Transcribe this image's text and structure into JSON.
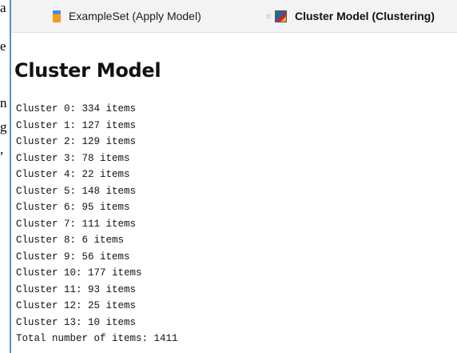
{
  "left_strip_letters": [
    "a",
    "e",
    "n",
    "g",
    ","
  ],
  "tabs": [
    {
      "label": "ExampleSet (Apply Model)",
      "icon": "table-icon",
      "active": false
    },
    {
      "label": "Cluster Model (Clustering)",
      "icon": "cluster-model-icon",
      "active": true
    }
  ],
  "close_glyph": "×",
  "heading": "Cluster Model",
  "clusters": [
    {
      "label": "Cluster 0: 334 items",
      "cluster": 0,
      "items": 334
    },
    {
      "label": "Cluster 1: 127 items",
      "cluster": 1,
      "items": 127
    },
    {
      "label": "Cluster 2: 129 items",
      "cluster": 2,
      "items": 129
    },
    {
      "label": "Cluster 3: 78 items",
      "cluster": 3,
      "items": 78
    },
    {
      "label": "Cluster 4: 22 items",
      "cluster": 4,
      "items": 22
    },
    {
      "label": "Cluster 5: 148 items",
      "cluster": 5,
      "items": 148
    },
    {
      "label": "Cluster 6: 95 items",
      "cluster": 6,
      "items": 95
    },
    {
      "label": "Cluster 7: 111 items",
      "cluster": 7,
      "items": 111
    },
    {
      "label": "Cluster 8: 6 items",
      "cluster": 8,
      "items": 6
    },
    {
      "label": "Cluster 9: 56 items",
      "cluster": 9,
      "items": 56
    },
    {
      "label": "Cluster 10: 177 items",
      "cluster": 10,
      "items": 177
    },
    {
      "label": "Cluster 11: 93 items",
      "cluster": 11,
      "items": 93
    },
    {
      "label": "Cluster 12: 25 items",
      "cluster": 12,
      "items": 25
    },
    {
      "label": "Cluster 13: 10 items",
      "cluster": 13,
      "items": 10
    }
  ],
  "total": {
    "label": "Total number of items: 1411",
    "value": 1411
  },
  "colors": {
    "panel_border": "#5b8bd0",
    "tabbar_bg": "#f3f3f3"
  }
}
